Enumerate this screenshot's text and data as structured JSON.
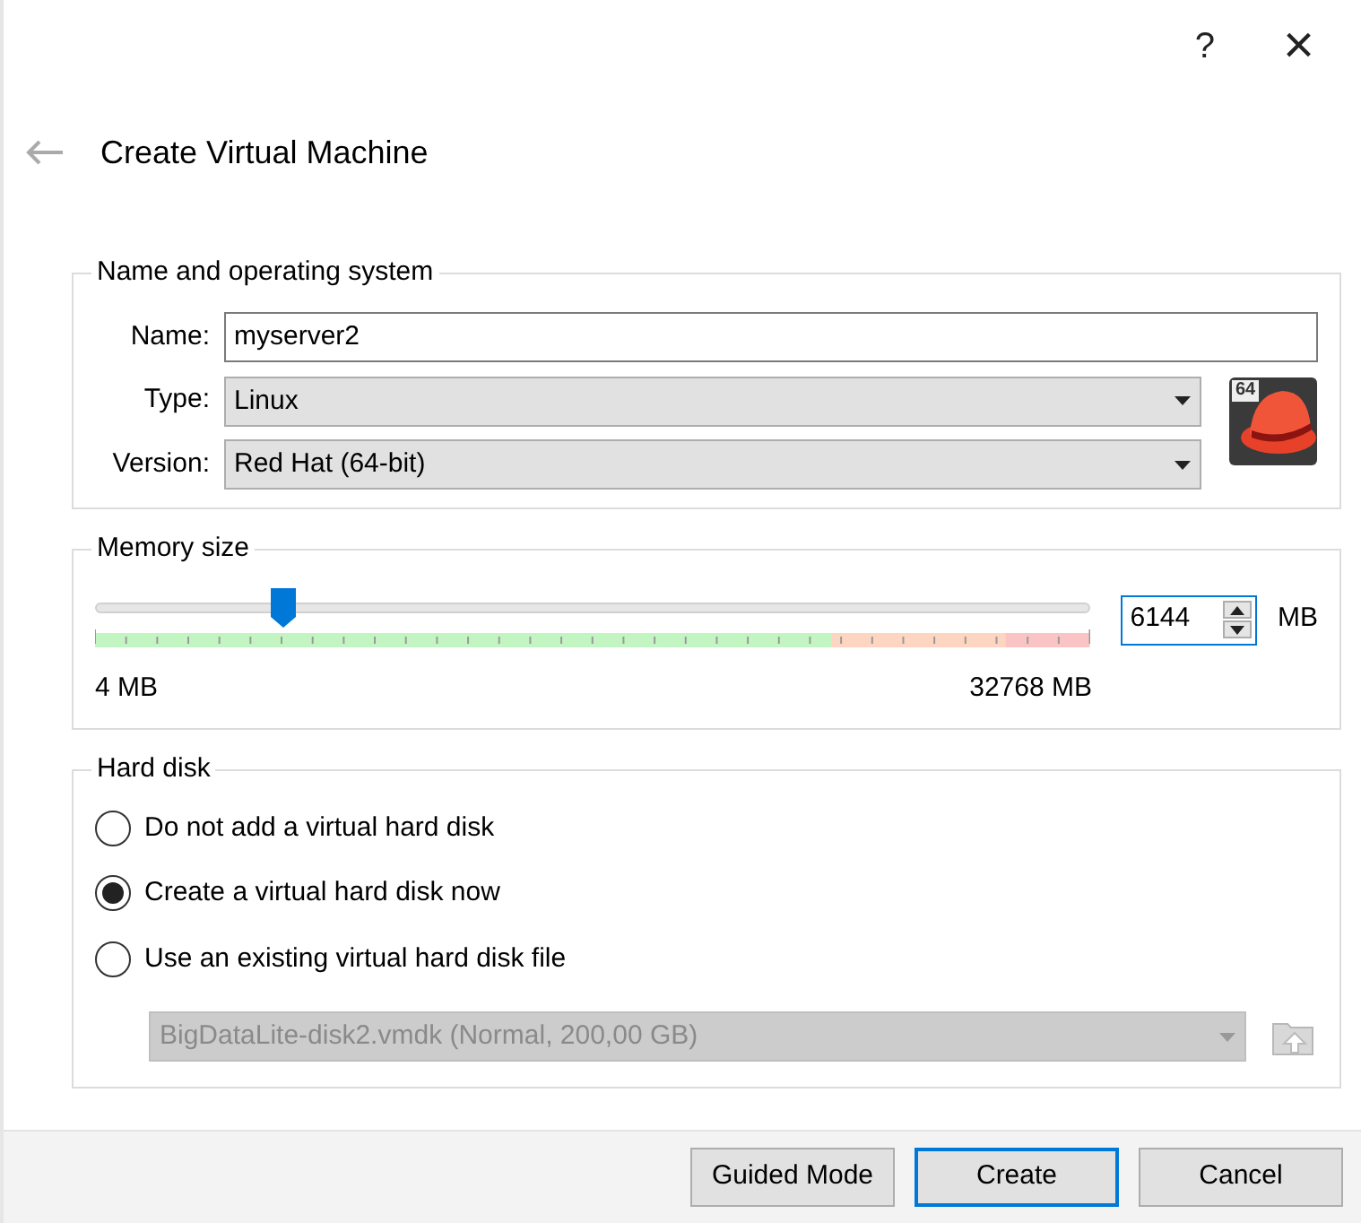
{
  "window": {
    "help": "?",
    "close": "×"
  },
  "title": "Create Virtual Machine",
  "name_os": {
    "legend": "Name and operating system",
    "name": {
      "label": "Name:",
      "value": "myserver2"
    },
    "type": {
      "label": "Type:",
      "value": "Linux"
    },
    "version": {
      "label": "Version:",
      "value": "Red Hat (64-bit)"
    },
    "os_badge": "64"
  },
  "memory": {
    "legend": "Memory size",
    "level": 0.19,
    "min_label": "4 MB",
    "max_label": "32768 MB",
    "value": "6144",
    "unit": "MB"
  },
  "hard_disk": {
    "legend": "Hard disk",
    "options": [
      {
        "label": "Do not add a virtual hard disk",
        "selected": false
      },
      {
        "label": "Create a virtual hard disk now",
        "selected": true
      },
      {
        "label": "Use an existing virtual hard disk file",
        "selected": false
      }
    ],
    "file": {
      "value": "BigDataLite-disk2.vmdk (Normal, 200,00 GB)",
      "disabled": true
    }
  },
  "buttons": [
    {
      "label": "Guided Mode",
      "default": false
    },
    {
      "label": "Create",
      "default": true
    },
    {
      "label": "Cancel",
      "default": false
    }
  ]
}
